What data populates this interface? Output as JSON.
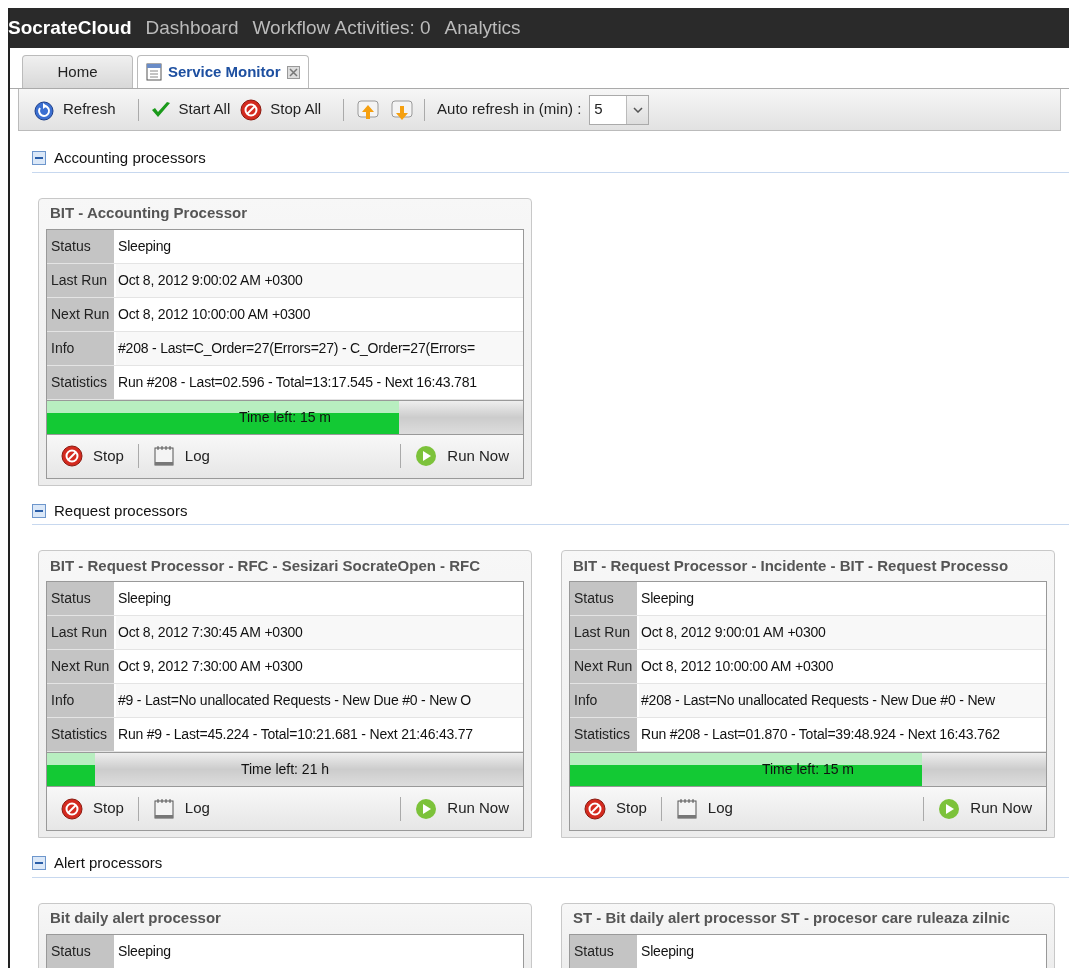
{
  "topbar": {
    "brand": "SocrateCloud",
    "links": [
      "Dashboard",
      "Workflow Activities: 0",
      "Analytics"
    ]
  },
  "tabs": [
    {
      "label": "Home",
      "selected": false,
      "closable": false
    },
    {
      "label": "Service Monitor",
      "selected": true,
      "closable": true
    }
  ],
  "toolbar": {
    "buttons": [
      {
        "kind": "refresh",
        "label": "Refresh"
      },
      {
        "kind": "start",
        "label": "Start All"
      },
      {
        "kind": "stop",
        "label": "Stop All"
      },
      {
        "kind": "expand"
      },
      {
        "kind": "collapse"
      }
    ],
    "auto_refresh": {
      "label": "Auto refresh in (min) :",
      "value": "5"
    }
  },
  "sections": [
    {
      "title": "Accounting processors",
      "expanded": true,
      "cards": [
        {
          "title": "BIT - Accounting Processor",
          "rows": [
            {
              "label": "Status",
              "value": "Sleeping"
            },
            {
              "label": "Last Run",
              "value": "Oct 8, 2012 9:00:02 AM +0300"
            },
            {
              "label": "Next Run",
              "value": "Oct 8, 2012 10:00:00 AM +0300"
            },
            {
              "label": "Info",
              "value": "#208 - Last=C_Order=27(Errors=27) - C_Order=27(Errors="
            },
            {
              "label": "Statistics",
              "value": "Run #208 - Last=02.596 - Total=13:17.545 - Next 16:43.781"
            }
          ],
          "progress": {
            "label": "Time left: 15 m",
            "level": 0.74
          },
          "actions": [
            "Stop",
            "Log",
            "Run Now"
          ]
        }
      ]
    },
    {
      "title": "Request processors",
      "expanded": true,
      "cards": [
        {
          "title": "BIT - Request Processor - RFC - Sesizari SocrateOpen - RFC",
          "rows": [
            {
              "label": "Status",
              "value": "Sleeping"
            },
            {
              "label": "Last Run",
              "value": "Oct 8, 2012 7:30:45 AM +0300"
            },
            {
              "label": "Next Run",
              "value": "Oct 9, 2012 7:30:00 AM +0300"
            },
            {
              "label": "Info",
              "value": "#9 - Last=No unallocated Requests - New Due #0 - New O"
            },
            {
              "label": "Statistics",
              "value": "Run #9 - Last=45.224 - Total=10:21.681 - Next 21:46:43.77"
            }
          ],
          "progress": {
            "label": "Time left: 21 h",
            "level": 0.1
          },
          "actions": [
            "Stop",
            "Log",
            "Run Now"
          ]
        },
        {
          "title": "BIT - Request Processor - Incidente - BIT - Request Processo",
          "rows": [
            {
              "label": "Status",
              "value": "Sleeping"
            },
            {
              "label": "Last Run",
              "value": "Oct 8, 2012 9:00:01 AM +0300"
            },
            {
              "label": "Next Run",
              "value": "Oct 8, 2012 10:00:00 AM +0300"
            },
            {
              "label": "Info",
              "value": "#208 - Last=No unallocated Requests - New Due #0 - New"
            },
            {
              "label": "Statistics",
              "value": "Run #208 - Last=01.870 - Total=39:48.924 - Next 16:43.762"
            }
          ],
          "progress": {
            "label": "Time left: 15 m",
            "level": 0.74
          },
          "actions": [
            "Stop",
            "Log",
            "Run Now"
          ]
        }
      ]
    },
    {
      "title": "Alert processors",
      "expanded": true,
      "cards": [
        {
          "title": "Bit daily alert processor",
          "rows": [
            {
              "label": "Status",
              "value": "Sleeping"
            }
          ]
        },
        {
          "title": "ST - Bit daily alert processor ST - procesor care ruleaza zilnic",
          "rows": [
            {
              "label": "Status",
              "value": "Sleeping"
            }
          ]
        }
      ]
    }
  ]
}
